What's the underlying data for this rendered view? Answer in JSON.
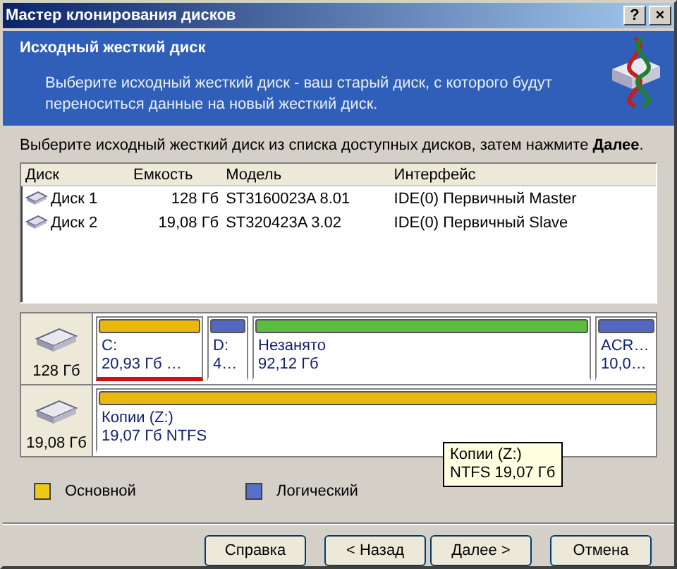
{
  "window": {
    "title": "Мастер клонирования дисков",
    "help": "?",
    "close": "×"
  },
  "header": {
    "title": "Исходный жесткий диск",
    "description": "Выберите исходный жесткий диск - ваш старый диск, с которого будут переноситься данные на новый жесткий диск."
  },
  "instruction": "Выберите исходный жесткий диск из списка доступных дисков, затем нажмите **Далее**.",
  "table": {
    "columns": [
      "Диск",
      "Емкость",
      "Модель",
      "Интерфейс"
    ],
    "rows": [
      {
        "disk": "Диск 1",
        "capacity": "128 Гб",
        "model": "ST3160023A 8.01",
        "interface": "IDE(0) Первичный Master"
      },
      {
        "disk": "Диск 2",
        "capacity": "19,08 Гб",
        "model": "ST320423A 3.02",
        "interface": "IDE(0) Первичный Slave"
      }
    ]
  },
  "disk_map": [
    {
      "size": "128 Гб",
      "partitions": [
        {
          "kind": "primary",
          "name": "C:",
          "info": "20,93 Гб  …",
          "selected": true
        },
        {
          "kind": "logical",
          "name": "D:",
          "info": "4…",
          "selected": false
        },
        {
          "kind": "unallocated",
          "name": "Незанято",
          "info": "92,12 Гб",
          "selected": false
        },
        {
          "kind": "logical",
          "name": "ACR…",
          "info": "10,0…",
          "selected": false
        }
      ]
    },
    {
      "size": "19,08 Гб",
      "partitions": [
        {
          "kind": "primary",
          "name": "Копии (Z:)",
          "info": "19,07 Гб  NTFS",
          "selected": false
        }
      ]
    }
  ],
  "tooltip": [
    "Копии (Z:)",
    "NTFS 19,07 Гб"
  ],
  "legend": [
    {
      "label": "Основной",
      "color": "#f0c818"
    },
    {
      "label": "Логический",
      "color": "#5870c8"
    }
  ],
  "buttons": [
    "Справка",
    "< Назад",
    "Далее >",
    "Отмена"
  ]
}
